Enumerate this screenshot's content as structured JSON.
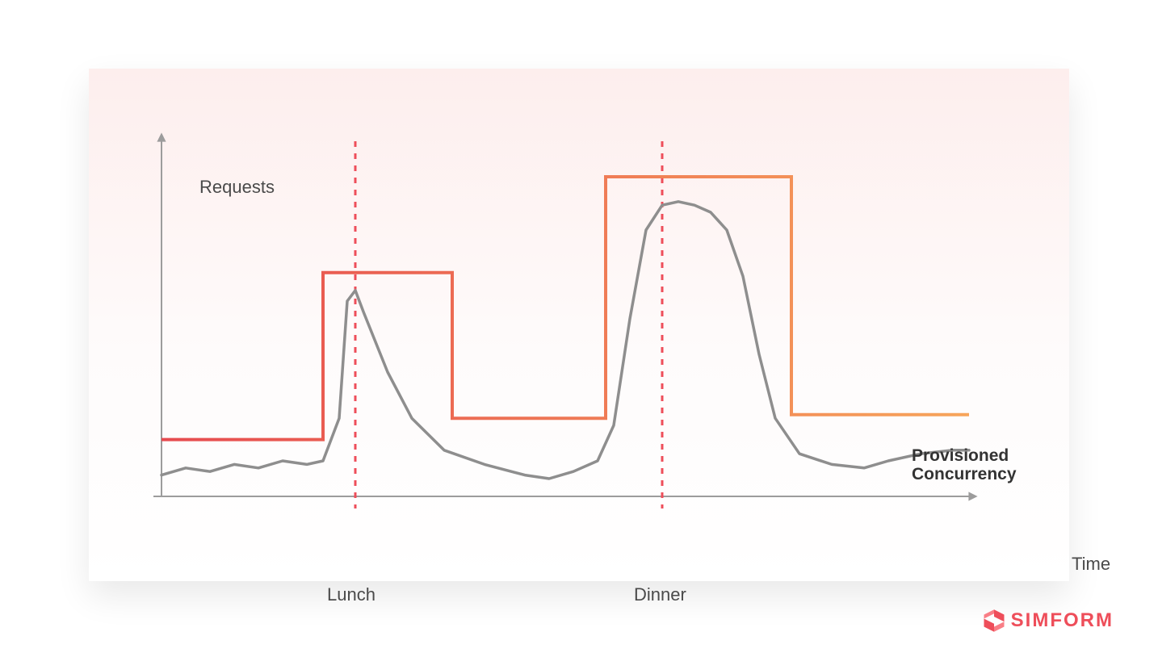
{
  "brand": {
    "name": "SIMFORM"
  },
  "chart_data": {
    "type": "line",
    "title": "",
    "xlabel": "Time",
    "ylabel": "Requests",
    "xlim": [
      0,
      100
    ],
    "ylim": [
      0,
      100
    ],
    "annotations": [
      {
        "name": "Lunch",
        "x": 24
      },
      {
        "name": "Dinner",
        "x": 62
      }
    ],
    "series": [
      {
        "name": "Provisioned Concurrency",
        "type": "step",
        "color_start": "#e64a4f",
        "color_end": "#f7a55b",
        "points": [
          {
            "x": 0,
            "y": 16
          },
          {
            "x": 20,
            "y": 16
          },
          {
            "x": 20,
            "y": 63
          },
          {
            "x": 36,
            "y": 63
          },
          {
            "x": 36,
            "y": 22
          },
          {
            "x": 55,
            "y": 22
          },
          {
            "x": 55,
            "y": 90
          },
          {
            "x": 78,
            "y": 90
          },
          {
            "x": 78,
            "y": 23
          },
          {
            "x": 100,
            "y": 23
          }
        ]
      },
      {
        "name": "Requests",
        "type": "line",
        "color": "#8e8e8e",
        "points": [
          {
            "x": 0,
            "y": 6
          },
          {
            "x": 3,
            "y": 8
          },
          {
            "x": 6,
            "y": 7
          },
          {
            "x": 9,
            "y": 9
          },
          {
            "x": 12,
            "y": 8
          },
          {
            "x": 15,
            "y": 10
          },
          {
            "x": 18,
            "y": 9
          },
          {
            "x": 20,
            "y": 10
          },
          {
            "x": 22,
            "y": 22
          },
          {
            "x": 23,
            "y": 55
          },
          {
            "x": 24,
            "y": 58
          },
          {
            "x": 25,
            "y": 52
          },
          {
            "x": 28,
            "y": 35
          },
          {
            "x": 31,
            "y": 22
          },
          {
            "x": 35,
            "y": 13
          },
          {
            "x": 40,
            "y": 9
          },
          {
            "x": 45,
            "y": 6
          },
          {
            "x": 48,
            "y": 5
          },
          {
            "x": 51,
            "y": 7
          },
          {
            "x": 54,
            "y": 10
          },
          {
            "x": 56,
            "y": 20
          },
          {
            "x": 58,
            "y": 50
          },
          {
            "x": 60,
            "y": 75
          },
          {
            "x": 62,
            "y": 82
          },
          {
            "x": 64,
            "y": 83
          },
          {
            "x": 66,
            "y": 82
          },
          {
            "x": 68,
            "y": 80
          },
          {
            "x": 70,
            "y": 75
          },
          {
            "x": 72,
            "y": 62
          },
          {
            "x": 74,
            "y": 40
          },
          {
            "x": 76,
            "y": 22
          },
          {
            "x": 79,
            "y": 12
          },
          {
            "x": 83,
            "y": 9
          },
          {
            "x": 87,
            "y": 8
          },
          {
            "x": 90,
            "y": 10
          },
          {
            "x": 94,
            "y": 12
          },
          {
            "x": 98,
            "y": 13
          },
          {
            "x": 100,
            "y": 13
          }
        ]
      }
    ],
    "legend": {
      "provisioned_label_line1": "Provisioned",
      "provisioned_label_line2": "Concurrency"
    }
  }
}
